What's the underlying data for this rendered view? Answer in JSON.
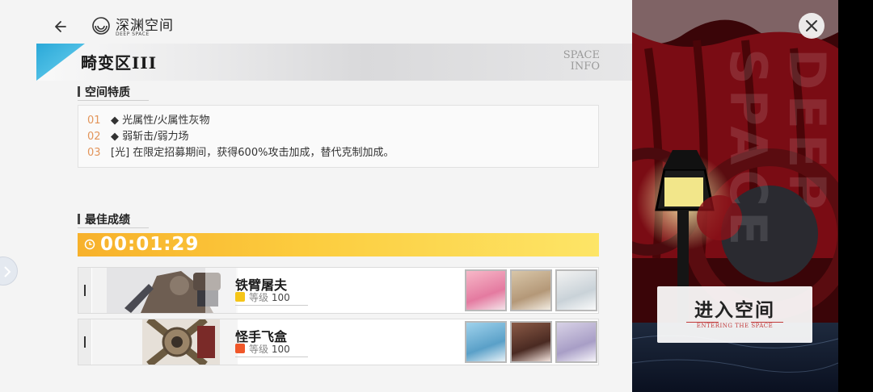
{
  "header": {
    "back_icon": "arrow-left-icon",
    "logo_icon": "deep-space-logo-icon",
    "title_cn": "深渊空间",
    "title_en": "DEEP SPACE"
  },
  "banner": {
    "title": "畸变区III",
    "tag_line1": "SPACE",
    "tag_line2": "INFO"
  },
  "features": {
    "heading": "空间特质",
    "items": [
      {
        "num": "01",
        "text": "◆ 光属性/火属性灰物"
      },
      {
        "num": "02",
        "text": "◆ 弱斩击/弱力场"
      },
      {
        "num": "03",
        "text": "[光] 在限定招募期间，获得600%攻击加成，替代克制加成。"
      }
    ]
  },
  "best": {
    "heading": "最佳成绩",
    "time": "00:01:29",
    "clock_icon": "clock-icon"
  },
  "bosses": [
    {
      "name": "铁臂屠夫",
      "level_label": "等级",
      "level": "100",
      "badge_color": "#f5c518"
    },
    {
      "name": "怪手飞盒",
      "level_label": "等级",
      "level": "100",
      "badge_color": "#f0572a"
    }
  ],
  "enter": {
    "label_cn": "进入空间",
    "label_en": "ENTERING THE SPACE"
  },
  "watermark": "DEEP SPACE",
  "colors": {
    "accent_orange": "#e3955a",
    "time_bar": "#fccd3f",
    "banner_tri": "#3bbde0",
    "enter_red": "#c23a3a"
  }
}
